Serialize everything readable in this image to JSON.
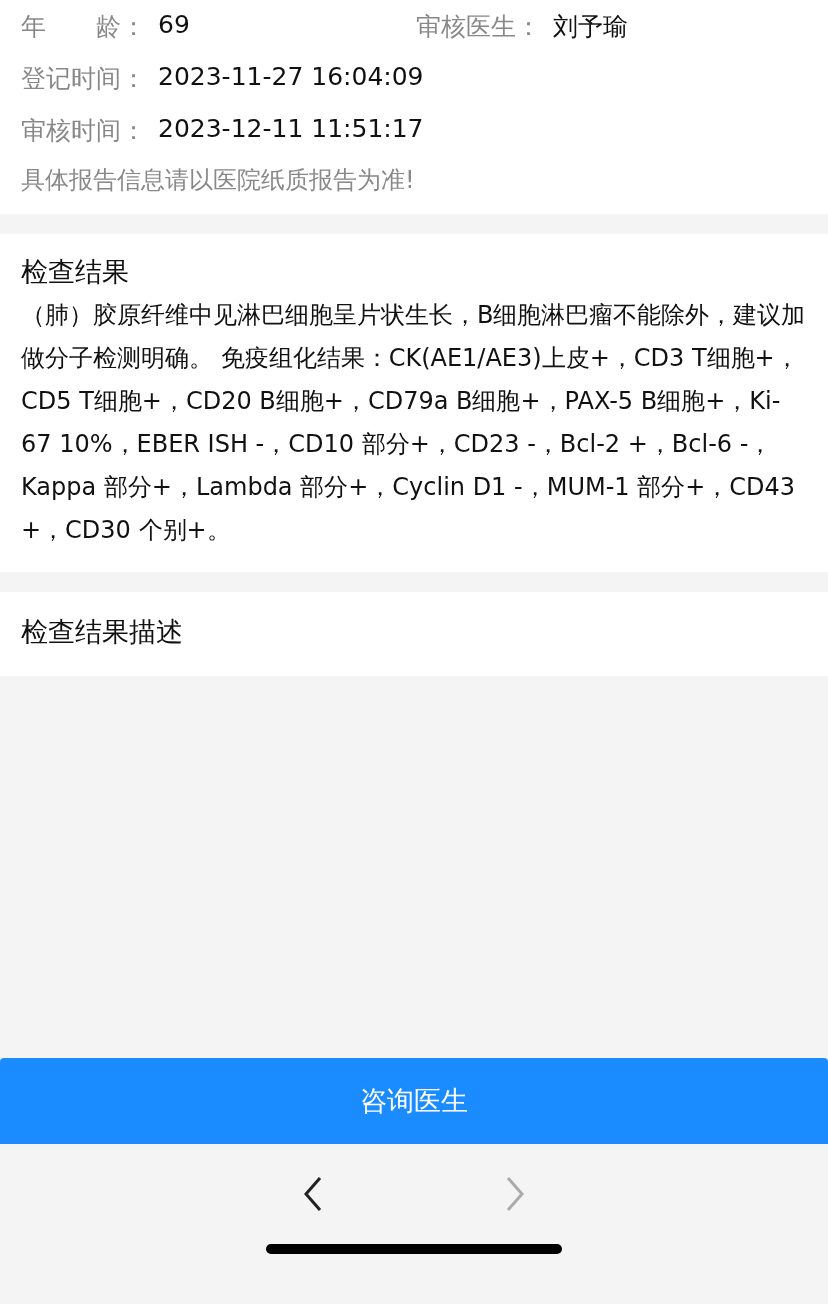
{
  "info": {
    "rows": [
      [
        {
          "label": "年　　龄：",
          "value": "69"
        },
        {
          "label": "审核医生：",
          "value": "刘予瑜"
        }
      ],
      [
        {
          "label": "登记时间：",
          "value": "2023-11-27 16:04:09"
        }
      ],
      [
        {
          "label": "审核时间：",
          "value": "2023-12-11 11:51:17"
        }
      ]
    ],
    "notice": "具体报告信息请以医院纸质报告为准!"
  },
  "result": {
    "title": "检查结果",
    "text": "（肺）胶原纤维中见淋巴细胞呈片状生长，B细胞淋巴瘤不能除外，建议加做分子检测明确。 免疫组化结果：CK(AE1/AE3)上皮+，CD3 T细胞+，CD5 T细胞+，CD20 B细胞+，CD79a B细胞+，PAX-5 B细胞+，Ki-67 10%，EBER ISH -，CD10 部分+，CD23 -，Bcl-2 +，Bcl-6 -，Kappa 部分+，Lambda 部分+，Cyclin D1 -，MUM-1 部分+，CD43 +，CD30 个别+。"
  },
  "description": {
    "title": "检查结果描述"
  },
  "consult_button": "咨询医生",
  "nav": {
    "back": {
      "disabled": false
    },
    "forward": {
      "disabled": true
    }
  }
}
